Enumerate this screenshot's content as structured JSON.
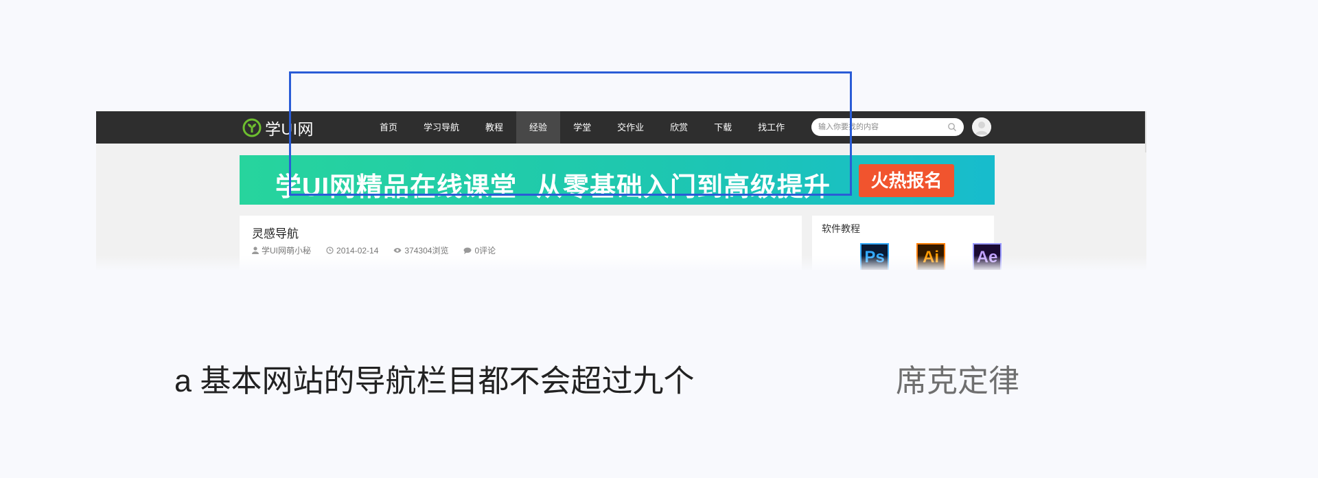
{
  "site": {
    "logo_text": "学UI网",
    "menu": [
      {
        "label": "首页",
        "active": false
      },
      {
        "label": "学习导航",
        "active": false
      },
      {
        "label": "教程",
        "active": false
      },
      {
        "label": "经验",
        "active": true
      },
      {
        "label": "学堂",
        "active": false
      },
      {
        "label": "交作业",
        "active": false
      },
      {
        "label": "欣赏",
        "active": false
      },
      {
        "label": "下载",
        "active": false
      },
      {
        "label": "找工作",
        "active": false
      }
    ],
    "search_placeholder": "输入你要找的内容",
    "banner": {
      "text_part1": "学UI网精品在线课堂",
      "text_part2": "从零基础入门到高级提升",
      "cta": "火热报名"
    },
    "article": {
      "title": "灵感导航",
      "author": "学UI网萌小秘",
      "date": "2014-02-14",
      "views": "374304浏览",
      "comments": "0评论"
    },
    "sidebar": {
      "title": "软件教程",
      "icons": [
        {
          "label": "Ps",
          "name": "photoshop"
        },
        {
          "label": "Ai",
          "name": "illustrator"
        },
        {
          "label": "Ae",
          "name": "after-effects"
        }
      ]
    }
  },
  "caption": "a 基本网站的导航栏目都不会超过九个",
  "law": "席克定律",
  "colors": {
    "nav_bg": "#2e2e2e",
    "nav_active": "#484848",
    "highlight": "#2a5cd6",
    "banner_cta": "#f1542e",
    "logo_green": "#6dbe2f"
  }
}
